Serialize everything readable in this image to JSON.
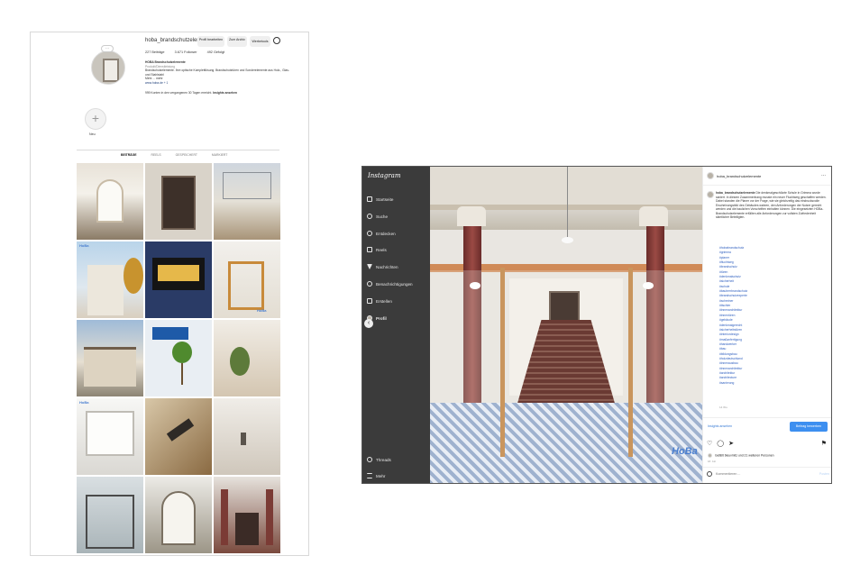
{
  "profile": {
    "username": "hoba_brandschutzelem...",
    "buttons": [
      "Profil bearbeiten",
      "Zum Archiv",
      "Werbetools"
    ],
    "stats": [
      "227 Beiträge",
      "3.671 Follower",
      "492 Gefolgt"
    ],
    "bio": {
      "name": "HOBA Brandschutzelemente",
      "category": "Produkt/Dienstleistung",
      "text": "Brandschutzelemente. Ihre optische Komplettlösung. Brandschutztüren und Sonderelemente aus Holz-, Glas- und Stahlstahl",
      "more": "Mehr ... mehr",
      "link": "www.hoba.de + 1"
    },
    "insights": "999 Konten in den vergangenen 30 Tagen erreicht.",
    "insights_link": "Insights ansehen",
    "highlight_label": "Neu",
    "tabs": [
      "BEITRÄGE",
      "REELS",
      "GESPEICHERT",
      "MARKIERT"
    ],
    "tile_tag": "HoBa"
  },
  "post": {
    "app_logo": "Instagram",
    "nav": [
      "Startseite",
      "Suche",
      "Entdecken",
      "Reels",
      "Nachrichten",
      "Benachrichtigungen",
      "Erstellen",
      "Profil",
      "Threads",
      "Mehr"
    ],
    "account": "hoba_brandschutzelemente",
    "more_dots": "...",
    "caption_user": "hoba_brandschutzelemente",
    "caption_text": "Die denkmalgeschützte Schule in Grimma wurde saniert. In diesem Zusammenhang musste ein neuer Fluchtweg geschaffen werden. Dabei standen die Planer vor der Frage, wie sie gleichzeitig das eindrucksvolle Erscheinungsbild des Gebäudes wahren, den Anforderungen der Nutzer gerecht werden und die baulichen Vorschriften einhalten können. Die eingesetzten HOBa-Brandschutzelemente erfüllten alle Anforderungen zur vollsten Zufriedenheit sämtlicher Beteiligten.",
    "hashtags": [
      "#hobabrandschutz",
      "#grimma",
      "#planer",
      "#fluchtweg",
      "#brandschutz",
      "#türen",
      "#denkmalschutz",
      "#sicherheit",
      "#schule",
      "#bauherrbrandschutz",
      "#brandschutzexperte",
      "#schreiner",
      "#tischler",
      "#innenarchitektur",
      "#innentüren",
      "#gebäude",
      "#denkmalgerecht",
      "#sicherheitstüren",
      "#interiordesign",
      "#maßanfertigung",
      "#handwerker",
      "#bau",
      "#bildungsbau",
      "#holzdeutschland",
      "#innenausbau",
      "#innenarchitektur",
      "#architektur",
      "#architecture",
      "#sanierung"
    ],
    "time_short": "14 Wo.",
    "insights_link": "Insights ansehen",
    "boost_button": "Beitrag bewerben",
    "likes": "Gefällt bleuvmitz und 21 weiteren Personen",
    "date": "18. Juli",
    "comment_placeholder": "Kommentieren ...",
    "post_button": "Posten",
    "watermark": "HoBa"
  },
  "colors": {
    "accent": "#3d8ff0",
    "link": "#2f5fbf",
    "sidebar": "#3b3b3b"
  }
}
